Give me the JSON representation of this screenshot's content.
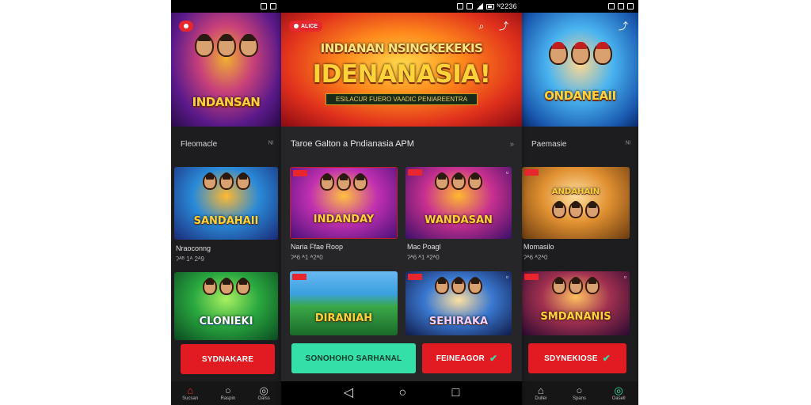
{
  "status": {
    "middle_time": "ᴺ2236"
  },
  "left_phone": {
    "banner_title": "INDANSAN",
    "section_label": "Fleomacle",
    "section_more": "ᴺᴵ",
    "cards": [
      {
        "title": "SANDAHAII",
        "name": "Nraoconng",
        "sub": "ʔᴬᴮ 1ᴬ 2ᴬ9"
      },
      {
        "title": "CLONIEKI",
        "name": "",
        "sub": ""
      }
    ],
    "install_label": "SYDNAKARE",
    "nav": [
      {
        "icon": "home-icon",
        "glyph": "⌂",
        "label": "Sucsan"
      },
      {
        "icon": "circle-icon",
        "glyph": "○",
        "label": "Raspin"
      },
      {
        "icon": "search-icon",
        "glyph": "◎",
        "label": "Oalss"
      }
    ]
  },
  "middle_phone": {
    "logo_label": "ALICE",
    "banner_title_small": "INDIANAN NSINGKEKEKIS",
    "banner_title_big": "IDENANASIA!",
    "banner_subtitle": "ESILACUR FUERO VAADIC PENIAREENTRA",
    "section_label": "Taroe  Galton a Pndianasia APM",
    "section_more": "»",
    "cards": [
      {
        "title": "INDANDAY",
        "name": "Naria Ffae Roop",
        "sub": "ʔᴬ6 ᴬ1 ᴬ2ᴬ0"
      },
      {
        "title": "WANDASAN",
        "name": "Mac Poagl",
        "sub": "ʔᴬ6 ᴬ1 ᴬ2ᴬ0"
      },
      {
        "title": "DIRANIAH",
        "name": "",
        "sub": ""
      },
      {
        "title": "SEHIRAKA",
        "name": "",
        "sub": ""
      }
    ],
    "teal_button_label": "SONOHOHO SARHANAL",
    "red_button_label": "FEINEAGOR",
    "sysnav": [
      {
        "icon": "back-icon",
        "glyph": "◁"
      },
      {
        "icon": "home-circle-icon",
        "glyph": "○"
      },
      {
        "icon": "recents-icon",
        "glyph": "□"
      }
    ]
  },
  "right_phone": {
    "banner_title": "ONDANEAII",
    "section_label": "Paemasie",
    "section_more": "ᴺᴵ",
    "cards": [
      {
        "title": "ANDAHAIN",
        "name": "Momasilo",
        "sub": "ʔᴬ6 ᴬ2ᴬ0"
      },
      {
        "title": "SMDANANIS",
        "name": "",
        "sub": ""
      }
    ],
    "install_label": "SDYNEKIOSE",
    "nav": [
      {
        "icon": "home-icon",
        "glyph": "⌂",
        "label": "Dullei"
      },
      {
        "icon": "circle-icon",
        "glyph": "○",
        "label": "Spans"
      },
      {
        "icon": "search-icon",
        "glyph": "◎",
        "label": "Oasell"
      }
    ]
  },
  "colors": {
    "accent_red": "#e21b22",
    "accent_teal": "#35e0a8",
    "phone_bg": "#1d1d1f"
  }
}
